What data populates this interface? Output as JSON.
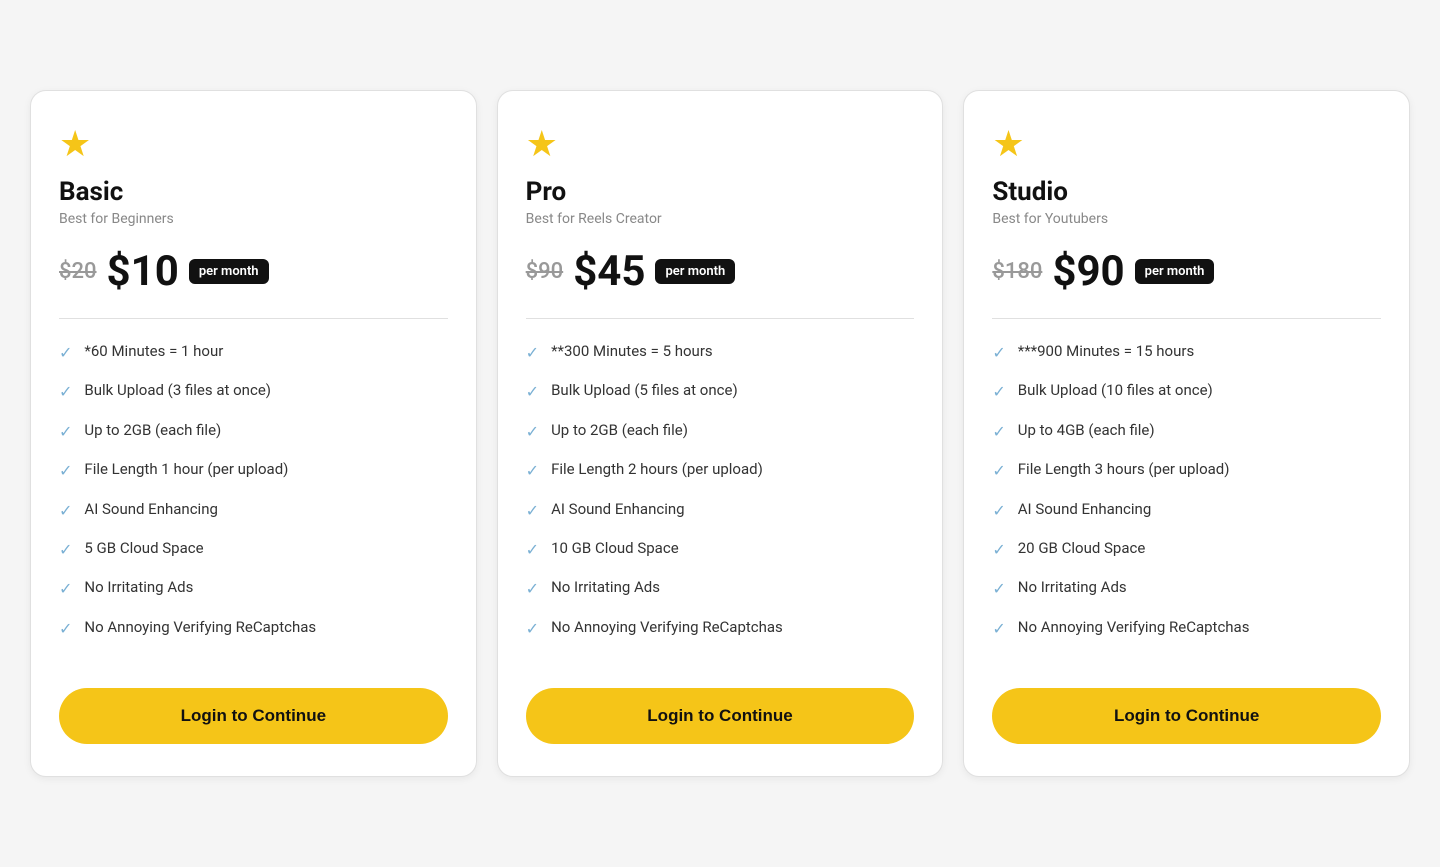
{
  "plans": [
    {
      "id": "basic",
      "star": "★",
      "name": "Basic",
      "tagline": "Best for Beginners",
      "price_original": "$20",
      "price_current": "$10",
      "per_month": "per month",
      "features": [
        "*60 Minutes = 1 hour",
        "Bulk Upload (3 files at once)",
        "Up to 2GB (each file)",
        "File Length 1 hour (per upload)",
        "AI Sound Enhancing",
        "5 GB Cloud Space",
        "No Irritating Ads",
        "No Annoying Verifying ReCaptchas"
      ],
      "button_label": "Login to Continue"
    },
    {
      "id": "pro",
      "star": "★",
      "name": "Pro",
      "tagline": "Best for Reels Creator",
      "price_original": "$90",
      "price_current": "$45",
      "per_month": "per month",
      "features": [
        "**300 Minutes = 5 hours",
        "Bulk Upload (5 files at once)",
        "Up to 2GB (each file)",
        "File Length 2 hours (per upload)",
        "AI Sound Enhancing",
        "10 GB Cloud Space",
        "No Irritating Ads",
        "No Annoying Verifying ReCaptchas"
      ],
      "button_label": "Login to Continue"
    },
    {
      "id": "studio",
      "star": "★",
      "name": "Studio",
      "tagline": "Best for Youtubers",
      "price_original": "$180",
      "price_current": "$90",
      "per_month": "per month",
      "features": [
        "***900 Minutes = 15 hours",
        "Bulk Upload (10 files at once)",
        "Up to 4GB (each file)",
        "File Length 3 hours (per upload)",
        "AI Sound Enhancing",
        "20 GB Cloud Space",
        "No Irritating Ads",
        "No Annoying Verifying ReCaptchas"
      ],
      "button_label": "Login to Continue"
    }
  ],
  "check_symbol": "✓"
}
